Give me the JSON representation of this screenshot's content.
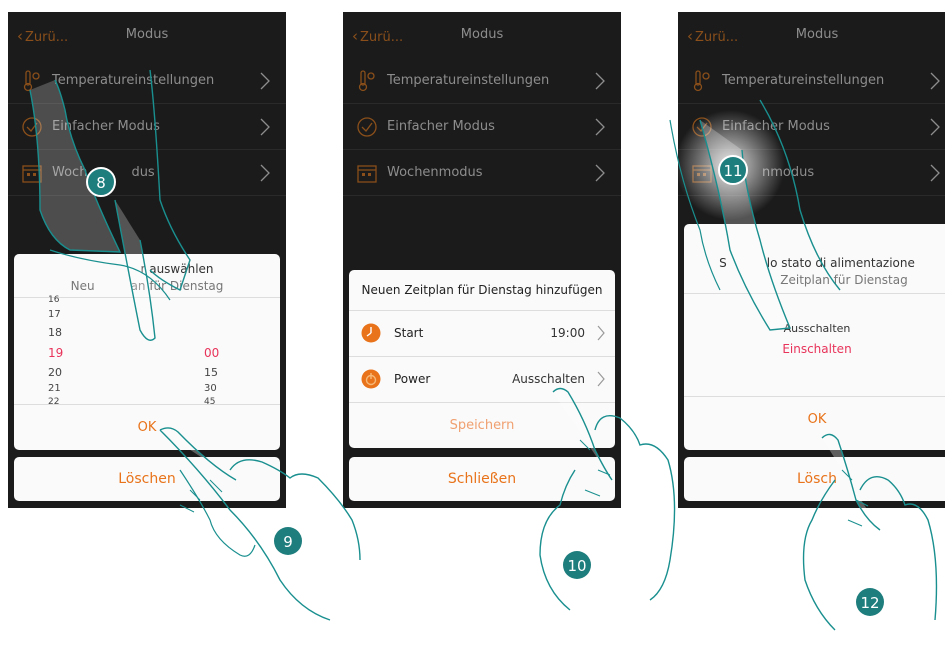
{
  "phone1": {
    "back_label": "Zurü...",
    "title": "Modus",
    "menu": [
      {
        "label": "Temperatureinstellungen",
        "icon": "thermometer-icon"
      },
      {
        "label": "Einfacher Modus",
        "icon": "check-circle-icon"
      },
      {
        "label": "Wochenmodus",
        "icon": "calendar-icon"
      }
    ],
    "menu_labels_partial": [
      "Temperatureinstellungen",
      "Einfacher Modus",
      "Woch",
      "dus"
    ],
    "dialog": {
      "title": "r auswählen",
      "subtitle_left": "Neu",
      "subtitle_right": "an für Dienstag",
      "hours": [
        "16",
        "17",
        "18",
        "19",
        "20",
        "21",
        "22"
      ],
      "selected_hour": "19",
      "minutes": [
        "00",
        "15",
        "30",
        "45"
      ],
      "selected_minute": "00",
      "ok_label": "OK"
    },
    "delete_label": "Löschen",
    "badge": "8"
  },
  "phone2": {
    "back_label": "Zurü...",
    "title": "Modus",
    "menu": [
      {
        "label": "Temperatureinstellungen",
        "icon": "thermometer-icon"
      },
      {
        "label": "Einfacher Modus",
        "icon": "check-circle-icon"
      },
      {
        "label": "Wochenmodus",
        "icon": "calendar-icon"
      }
    ],
    "dialog": {
      "title": "Neuen Zeitplan für Dienstag hinzufügen",
      "rows": [
        {
          "label": "Start",
          "value": "19:00",
          "icon": "clock-icon"
        },
        {
          "label": "Power",
          "value": "Ausschalten",
          "icon": "power-icon"
        }
      ],
      "save_label": "Speichern"
    },
    "close_label": "Schließen",
    "badge": "10"
  },
  "phone3": {
    "back_label": "Zurü...",
    "title": "Modus",
    "menu": [
      {
        "label": "Temperatureinstellungen",
        "icon": "thermometer-icon"
      },
      {
        "label": "Einfacher Modus",
        "icon": "check-circle-icon"
      },
      {
        "label": "Wochenmodus",
        "icon": "calendar-icon"
      }
    ],
    "menu_labels_partial": [
      "Temperatureinstellungen",
      "Einfacher",
      "Modus",
      "nmodus"
    ],
    "dialog": {
      "title_left": "S",
      "title_right": "lo stato di alimentazione",
      "subtitle": "Zeitplan für Dienstag",
      "options": [
        "Ausschalten",
        "Einschalten"
      ],
      "selected_option": "Einschalten",
      "ok_label": "OK"
    },
    "delete_label": "Lösch",
    "badges": [
      "11",
      "12"
    ]
  },
  "extra_badge": "9",
  "colors": {
    "screen_bg": "#1b1b1b",
    "accent_orange": "#e8731a",
    "selected_red": "#e8335a",
    "hand_outline": "#1a8f8f",
    "badge_teal": "#1e7d7d"
  }
}
